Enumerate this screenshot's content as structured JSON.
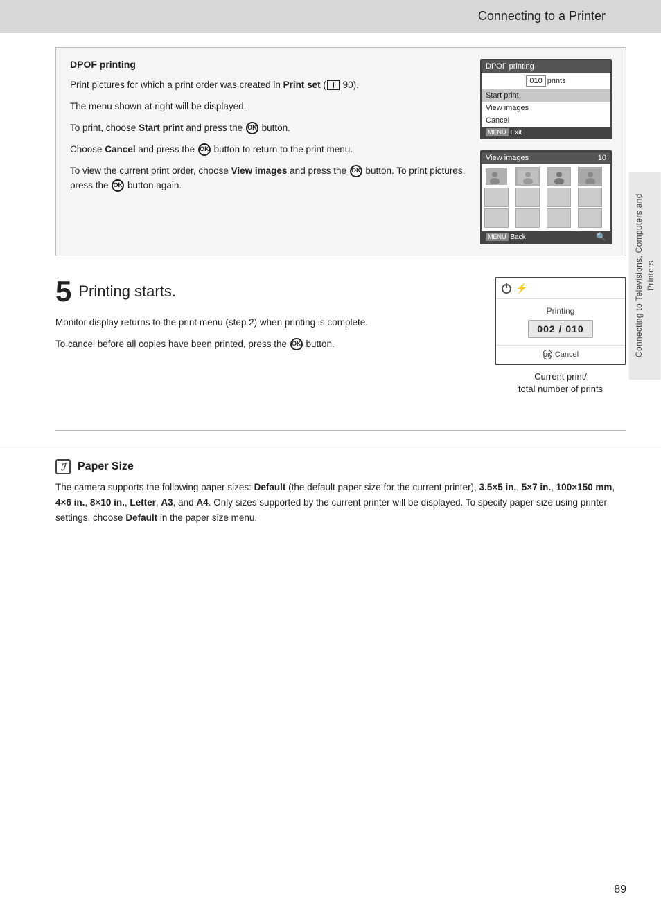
{
  "header": {
    "title": "Connecting to a Printer",
    "bg_color": "#d8d8d8"
  },
  "dpof_section": {
    "title": "DPOF printing",
    "paragraphs": [
      "Print pictures for which a print order was created in Print set (  90).",
      "The menu shown at right will be displayed.",
      "To print, choose Start print and press the  button.",
      "Choose Cancel and press the  button to return to the print menu.",
      "To view the current print order, choose View images and press the  button. To print pictures, press the  button again."
    ],
    "screen1": {
      "title": "DPOF printing",
      "prints_value": "010",
      "prints_label": "prints",
      "menu_items": [
        "Start print",
        "View images",
        "Cancel"
      ],
      "selected_item": "Start print",
      "footer_label": "MENU",
      "footer_text": "Exit"
    },
    "screen2": {
      "title": "View images",
      "count": "10",
      "footer_label": "MENU",
      "footer_text": "Back",
      "search_icon": "🔍"
    }
  },
  "step5": {
    "number": "5",
    "title": "Printing starts.",
    "paragraphs": [
      "Monitor display returns to the print menu (step 2) when printing is complete.",
      "To cancel before all copies have been printed, press the  button."
    ],
    "printing_screen": {
      "printing_label": "Printing",
      "counter": "002 / 010",
      "cancel_label": "Cancel",
      "ok_label": "OK"
    },
    "caption": "Current print/\ntotal number of prints"
  },
  "side_label": {
    "text": "Connecting to Televisions, Computers and Printers"
  },
  "paper_size": {
    "icon_text": "ℐ",
    "title": "Paper Size",
    "text_parts": [
      "The camera supports the following paper sizes: ",
      "Default",
      " (the default paper size for the current printer), ",
      "3.5×5 in.",
      ", ",
      "5×7 in.",
      ", ",
      "100×150 mm",
      ", ",
      "4×6 in.",
      ", ",
      "8×10 in.",
      ", ",
      "Letter",
      ", ",
      "A3",
      ", and ",
      "A4",
      ". Only sizes supported by the current printer will be displayed. To specify paper size using printer settings, choose ",
      "Default",
      " in the paper size menu."
    ]
  },
  "page_number": "89"
}
